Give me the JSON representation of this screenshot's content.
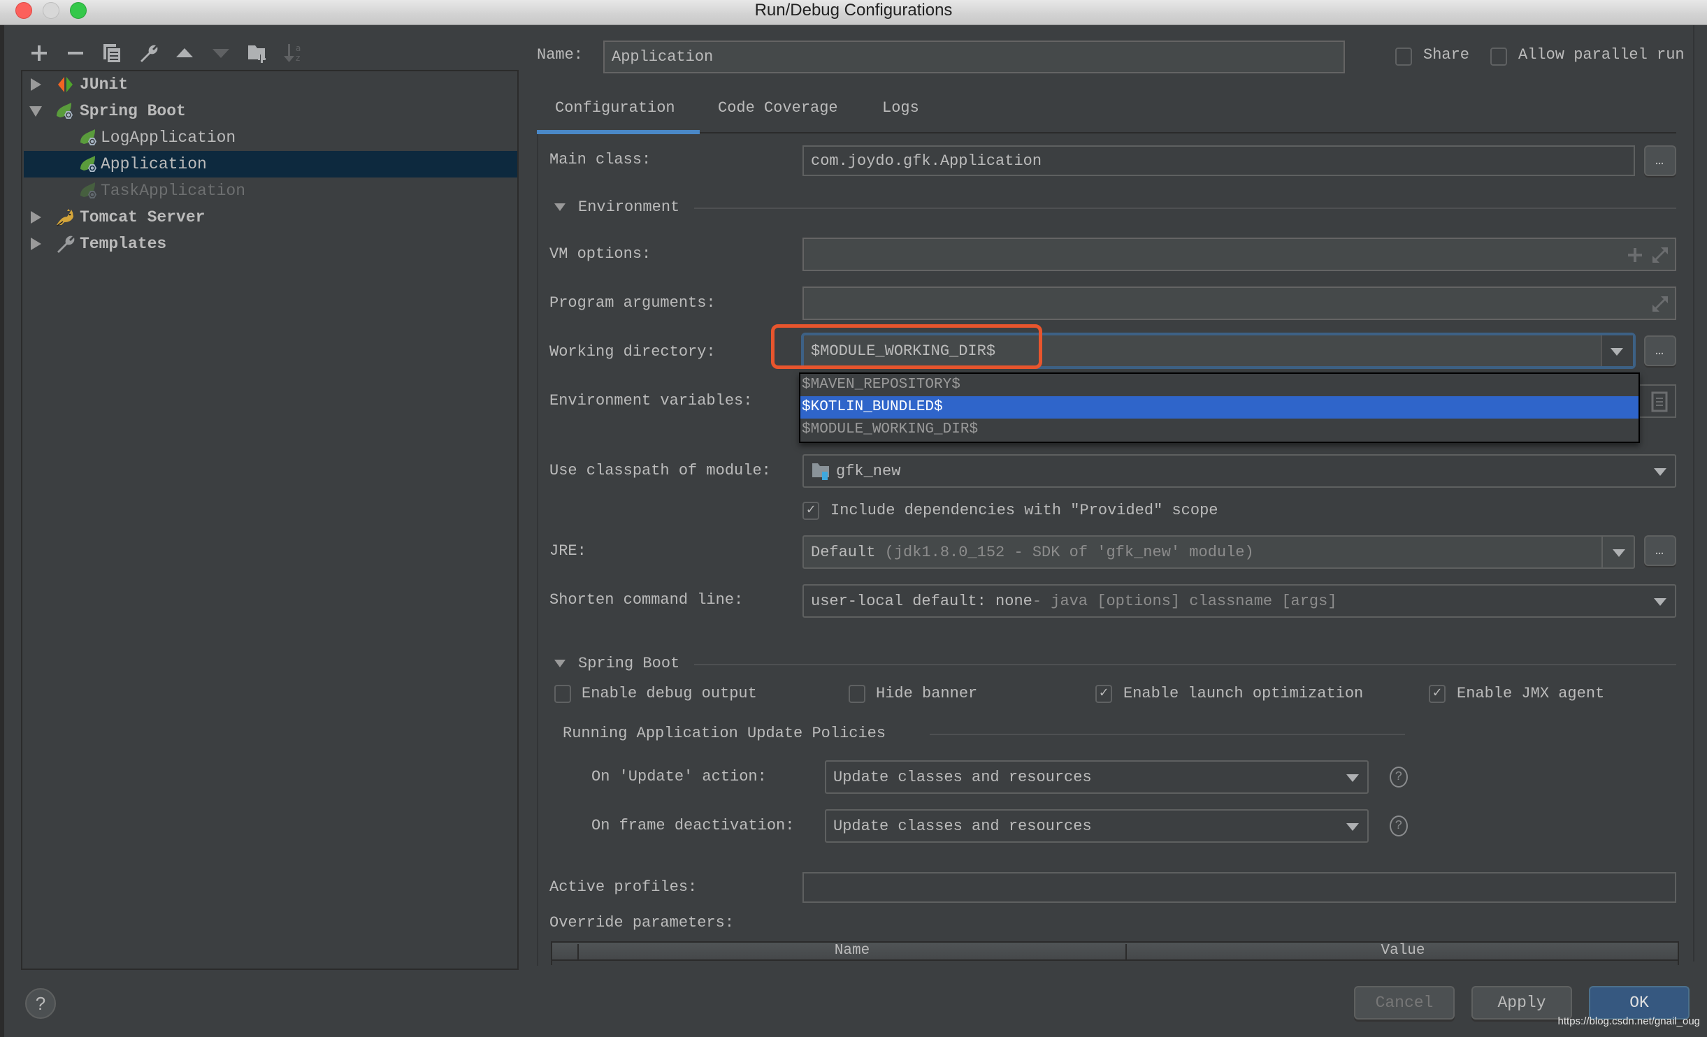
{
  "window": {
    "title": "Run/Debug Configurations"
  },
  "toolbar": {
    "items": [
      {
        "icon": "plus-icon",
        "label": "Add New Configuration"
      },
      {
        "icon": "minus-icon",
        "label": "Remove Configuration"
      },
      {
        "icon": "copy-icon",
        "label": "Copy Configuration"
      },
      {
        "icon": "wrench-icon",
        "label": "Edit Defaults"
      },
      {
        "icon": "move-up-icon",
        "label": "Move Up"
      },
      {
        "icon": "move-down-icon",
        "label": "Move Down"
      },
      {
        "icon": "new-folder-icon",
        "label": "Create New Folder"
      },
      {
        "icon": "sort-alpha-icon",
        "label": "Sort Configurations"
      }
    ]
  },
  "tree": {
    "items": [
      {
        "label": "JUnit",
        "icon": "junit-icon",
        "level": 0,
        "expanded": false,
        "bold": true
      },
      {
        "label": "Spring Boot",
        "icon": "spring-boot-icon",
        "level": 0,
        "expanded": true,
        "bold": true
      },
      {
        "label": "LogApplication",
        "icon": "spring-boot-icon",
        "level": 1
      },
      {
        "label": "Application",
        "icon": "spring-boot-icon",
        "level": 1,
        "selected": true
      },
      {
        "label": "TaskApplication",
        "icon": "spring-boot-icon",
        "level": 1,
        "disabled": true
      },
      {
        "label": "Tomcat Server",
        "icon": "tomcat-icon",
        "level": 0,
        "expanded": false,
        "bold": true
      },
      {
        "label": "Templates",
        "icon": "wrench-icon",
        "level": 0,
        "expanded": false,
        "bold": true
      }
    ]
  },
  "header": {
    "name_label": "Name:",
    "name_value": "Application",
    "share_label": "Share",
    "share_checked": false,
    "parallel_label": "Allow parallel run",
    "parallel_checked": false
  },
  "tabs": [
    {
      "label": "Configuration",
      "active": true
    },
    {
      "label": "Code Coverage",
      "active": false
    },
    {
      "label": "Logs",
      "active": false
    }
  ],
  "config": {
    "main_class_label": "Main class:",
    "main_class_value": "com.joydo.gfk.Application",
    "environment_section": "Environment",
    "vm_options_label": "VM options:",
    "vm_options_value": "",
    "program_args_label": "Program arguments:",
    "program_args_value": "",
    "working_dir_label": "Working directory:",
    "working_dir_value": "$MODULE_WORKING_DIR$",
    "working_dir_options": [
      "$MAVEN_REPOSITORY$",
      "$KOTLIN_BUNDLED$",
      "$MODULE_WORKING_DIR$"
    ],
    "working_dir_highlighted_option": "$KOTLIN_BUNDLED$",
    "env_vars_label": "Environment variables:",
    "classpath_label": "Use classpath of module:",
    "classpath_value": "gfk_new",
    "include_provided_label": "Include dependencies with \"Provided\" scope",
    "include_provided_checked": true,
    "jre_label": "JRE:",
    "jre_value_prefix": "Default",
    "jre_value_detail": "(jdk1.8.0_152 - SDK of 'gfk_new' module)",
    "shorten_label": "Shorten command line:",
    "shorten_value_prefix": "user-local default: none",
    "shorten_value_detail": " - java [options] classname [args]"
  },
  "spring_boot": {
    "section": "Spring Boot",
    "checkboxes": [
      {
        "label": "Enable debug output",
        "checked": false
      },
      {
        "label": "Hide banner",
        "checked": false
      },
      {
        "label": "Enable launch optimization",
        "checked": true
      },
      {
        "label": "Enable JMX agent",
        "checked": true
      }
    ],
    "update_policies_title": "Running Application Update Policies",
    "on_update_label": "On 'Update' action:",
    "on_update_value": "Update classes and resources",
    "on_frame_label": "On frame deactivation:",
    "on_frame_value": "Update classes and resources",
    "active_profiles_label": "Active profiles:",
    "active_profiles_value": "",
    "override_label": "Override parameters:",
    "table_columns": [
      "Name",
      "Value"
    ]
  },
  "buttons": {
    "help": "?",
    "cancel": "Cancel",
    "apply": "Apply",
    "ok": "OK"
  },
  "watermark": "https://blog.csdn.net/gnail_oug",
  "colors": {
    "background": "#3c3f41",
    "selection": "#0d293e",
    "popup_highlight": "#2f65ca",
    "tab_underline": "#4a88c7",
    "annotation_box": "#e8552d",
    "primary_button": "#365880"
  }
}
